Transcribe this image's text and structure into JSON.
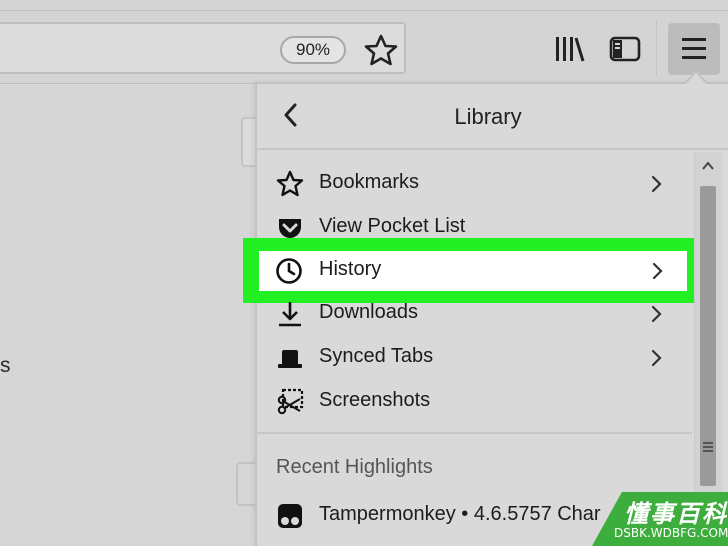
{
  "toolbar": {
    "zoom_level": "90%",
    "icons": [
      "star-icon",
      "library-icon",
      "sidebar-icon",
      "hamburger-menu-icon"
    ]
  },
  "page_fragment": {
    "text": "s"
  },
  "panel": {
    "title": "Library",
    "items": [
      {
        "label": "Bookmarks",
        "icon": "star-icon",
        "has_submenu": true
      },
      {
        "label": "View Pocket List",
        "icon": "pocket-icon",
        "has_submenu": false
      },
      {
        "label": "History",
        "icon": "clock-icon",
        "has_submenu": true,
        "highlighted": true
      },
      {
        "label": "Downloads",
        "icon": "download-icon",
        "has_submenu": true
      },
      {
        "label": "Synced Tabs",
        "icon": "synced-tabs-icon",
        "has_submenu": true
      },
      {
        "label": "Screenshots",
        "icon": "screenshot-icon",
        "has_submenu": false
      }
    ],
    "recent_section_title": "Recent Highlights",
    "recent_items": [
      {
        "label": "Tampermonkey • 4.6.5757 Char",
        "icon": "tampermonkey-icon"
      }
    ]
  },
  "colors": {
    "highlight": "#22f022",
    "watermark": "#3dae3d"
  },
  "watermark": {
    "cn": "懂事百科",
    "en": "DSBK.WDBFG.COM"
  }
}
